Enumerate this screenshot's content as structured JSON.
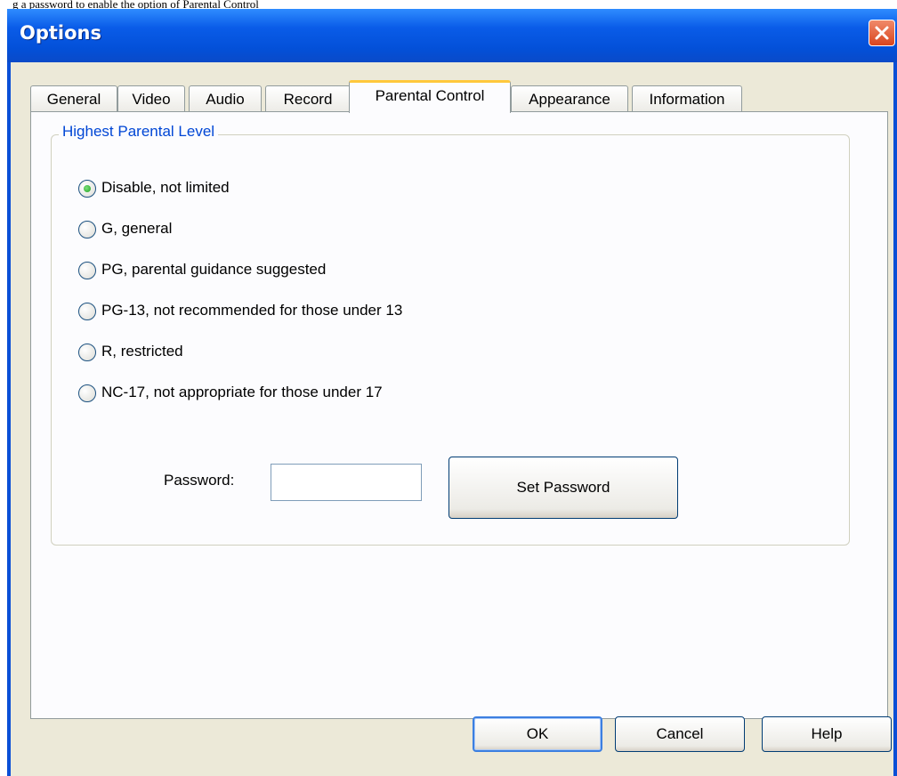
{
  "top_strip": "g a password to enable the option of Parental Control",
  "window": {
    "title": "Options"
  },
  "tabs": [
    {
      "label": "General"
    },
    {
      "label": "Video"
    },
    {
      "label": "Audio"
    },
    {
      "label": "Record"
    },
    {
      "label": "Parental Control",
      "active": true
    },
    {
      "label": "Appearance"
    },
    {
      "label": "Information"
    }
  ],
  "group": {
    "label": "Highest Parental Level",
    "options": [
      {
        "label": "Disable, not limited",
        "selected": true
      },
      {
        "label": "G, general",
        "selected": false
      },
      {
        "label": "PG, parental guidance suggested",
        "selected": false
      },
      {
        "label": "PG-13, not recommended for those under 13",
        "selected": false
      },
      {
        "label": "R, restricted",
        "selected": false
      },
      {
        "label": "NC-17, not appropriate for those under 17",
        "selected": false
      }
    ]
  },
  "password": {
    "label": "Password:",
    "value": "",
    "button": "Set Password"
  },
  "buttons": {
    "ok": "OK",
    "cancel": "Cancel",
    "help": "Help"
  },
  "colors": {
    "title_bar": "#0a5ce8",
    "dialog_bg": "#ece9d8",
    "group_label": "#0046d5",
    "close_button": "#d9451e",
    "active_tab_accent": "#ffc83c"
  }
}
